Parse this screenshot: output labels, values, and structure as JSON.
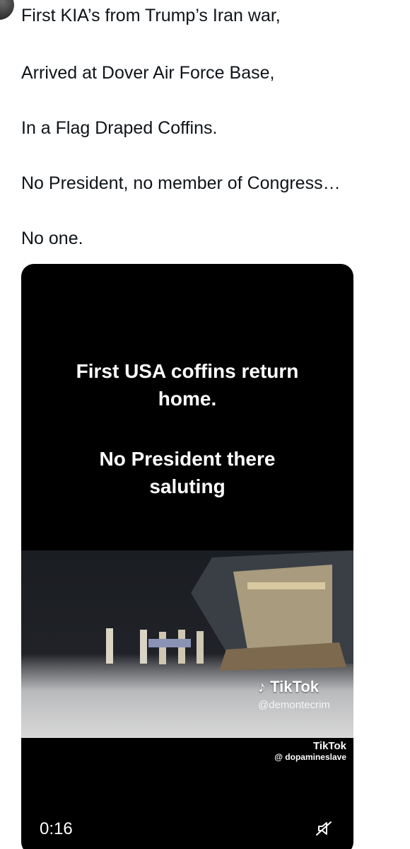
{
  "tweet": {
    "lines": [
      "First KIA’s from Trump’s Iran war,",
      "Arrived at Dover Air Force Base,",
      "In a Flag Draped Coffins.",
      "No President, no member of Congress…",
      "No one."
    ]
  },
  "video": {
    "caption_line1": "First USA coffins return",
    "caption_line2": "home.",
    "caption_line3": "No President there",
    "caption_line4": "saluting",
    "watermark_brand": "TikTok",
    "watermark_handle": "@demontecrim",
    "watermark2_brand": "TikTok",
    "watermark2_handle": "@ dopamineslave",
    "duration": "0:16",
    "mute_icon": "speaker-muted-icon"
  }
}
